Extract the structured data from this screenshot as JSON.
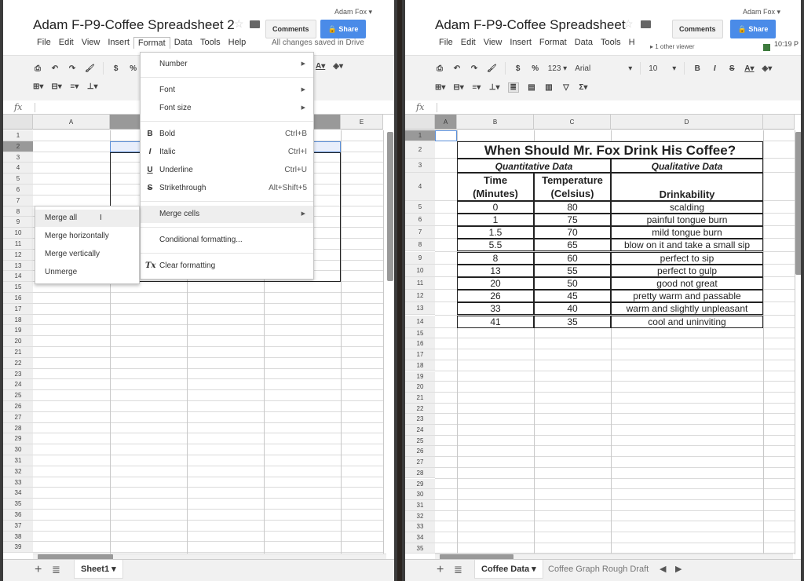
{
  "left": {
    "user": "Adam Fox ▾",
    "title": "Adam F-P9-Coffee Spreadsheet 2",
    "comments_label": "Comments",
    "share_label": "Share",
    "menu": [
      "File",
      "Edit",
      "View",
      "Insert",
      "Format",
      "Data",
      "Tools",
      "Help"
    ],
    "save_status": "All changes saved in Drive",
    "columns": [
      "A",
      "",
      "",
      "",
      "E"
    ],
    "rows": [
      "1",
      "2",
      "3",
      "4",
      "5",
      "6",
      "7",
      "8",
      "9",
      "10",
      "11",
      "12",
      "13",
      "14",
      "15",
      "16",
      "17",
      "18",
      "19",
      "20",
      "21",
      "22",
      "23",
      "24",
      "25",
      "26",
      "27",
      "28",
      "29",
      "30",
      "31",
      "32",
      "33",
      "34",
      "35",
      "36",
      "37",
      "38",
      "39"
    ],
    "format_menu": {
      "items": [
        {
          "label": "Number",
          "submenu": true
        },
        {
          "label": "Font",
          "submenu": true
        },
        {
          "label": "Font size",
          "submenu": true
        },
        {
          "icon": "B",
          "label": "Bold",
          "shortcut": "Ctrl+B"
        },
        {
          "icon": "I",
          "label": "Italic",
          "shortcut": "Ctrl+I"
        },
        {
          "icon": "U",
          "label": "Underline",
          "shortcut": "Ctrl+U"
        },
        {
          "icon": "S",
          "label": "Strikethrough",
          "shortcut": "Alt+Shift+5"
        },
        {
          "label": "Merge cells",
          "submenu": true
        },
        {
          "label": "Conditional formatting..."
        },
        {
          "icon": "Tx",
          "label": "Clear formatting"
        }
      ]
    },
    "merge_submenu": [
      "Merge all",
      "Merge horizontally",
      "Merge vertically",
      "Unmerge"
    ],
    "sheet_tab": "Sheet1 ▾",
    "toolbar_icons": [
      "print",
      "undo",
      "redo",
      "paint-format",
      "$",
      "%"
    ]
  },
  "right": {
    "user": "Adam Fox ▾",
    "title": "Adam F-P9-Coffee Spreadsheet",
    "comments_label": "Comments",
    "share_label": "Share",
    "menu": [
      "File",
      "Edit",
      "View",
      "Insert",
      "Format",
      "Data",
      "Tools",
      "H"
    ],
    "viewer_text": "▸ 1 other viewer",
    "clock": "10:19 P",
    "font_name": "Arial",
    "font_size": "10",
    "num_format": "123 ▾",
    "columns": [
      "A",
      "B",
      "C",
      "D",
      ""
    ],
    "rows": [
      "1",
      "2",
      "3",
      "4",
      "5",
      "6",
      "7",
      "8",
      "9",
      "10",
      "11",
      "12",
      "13",
      "14",
      "15",
      "16",
      "17",
      "18",
      "19",
      "20",
      "21",
      "22",
      "23",
      "24",
      "25",
      "26",
      "27",
      "28",
      "29",
      "30",
      "31",
      "32",
      "33",
      "34",
      "35"
    ],
    "sheet": {
      "heading": "When Should Mr. Fox Drink His Coffee?",
      "quant_header": "Quantitative Data",
      "qual_header": "Qualitative Data",
      "col_time": "Time (Minutes)",
      "col_time_l1": "Time",
      "col_time_l2": "(Minutes)",
      "col_temp_l1": "Temperature",
      "col_temp_l2": "(Celsius)",
      "col_drink": "Drinkability",
      "data": [
        {
          "time": "0",
          "temp": "80",
          "drink": "scalding"
        },
        {
          "time": "1",
          "temp": "75",
          "drink": "painful tongue burn"
        },
        {
          "time": "1.5",
          "temp": "70",
          "drink": "mild tongue burn"
        },
        {
          "time": "5.5",
          "temp": "65",
          "drink": "blow on it and take a small sip"
        },
        {
          "time": "8",
          "temp": "60",
          "drink": "perfect to sip"
        },
        {
          "time": "13",
          "temp": "55",
          "drink": "perfect to gulp"
        },
        {
          "time": "20",
          "temp": "50",
          "drink": "good not great"
        },
        {
          "time": "26",
          "temp": "45",
          "drink": "pretty warm and passable"
        },
        {
          "time": "33",
          "temp": "40",
          "drink": "warm and slightly unpleasant"
        },
        {
          "time": "41",
          "temp": "35",
          "drink": "cool and uninviting"
        }
      ]
    },
    "tabs": [
      "Coffee Data ▾",
      "Coffee Graph Rough Draft"
    ]
  },
  "colors": {
    "share_blue": "#4a8be8",
    "presence_green": "#3d7a3d"
  }
}
